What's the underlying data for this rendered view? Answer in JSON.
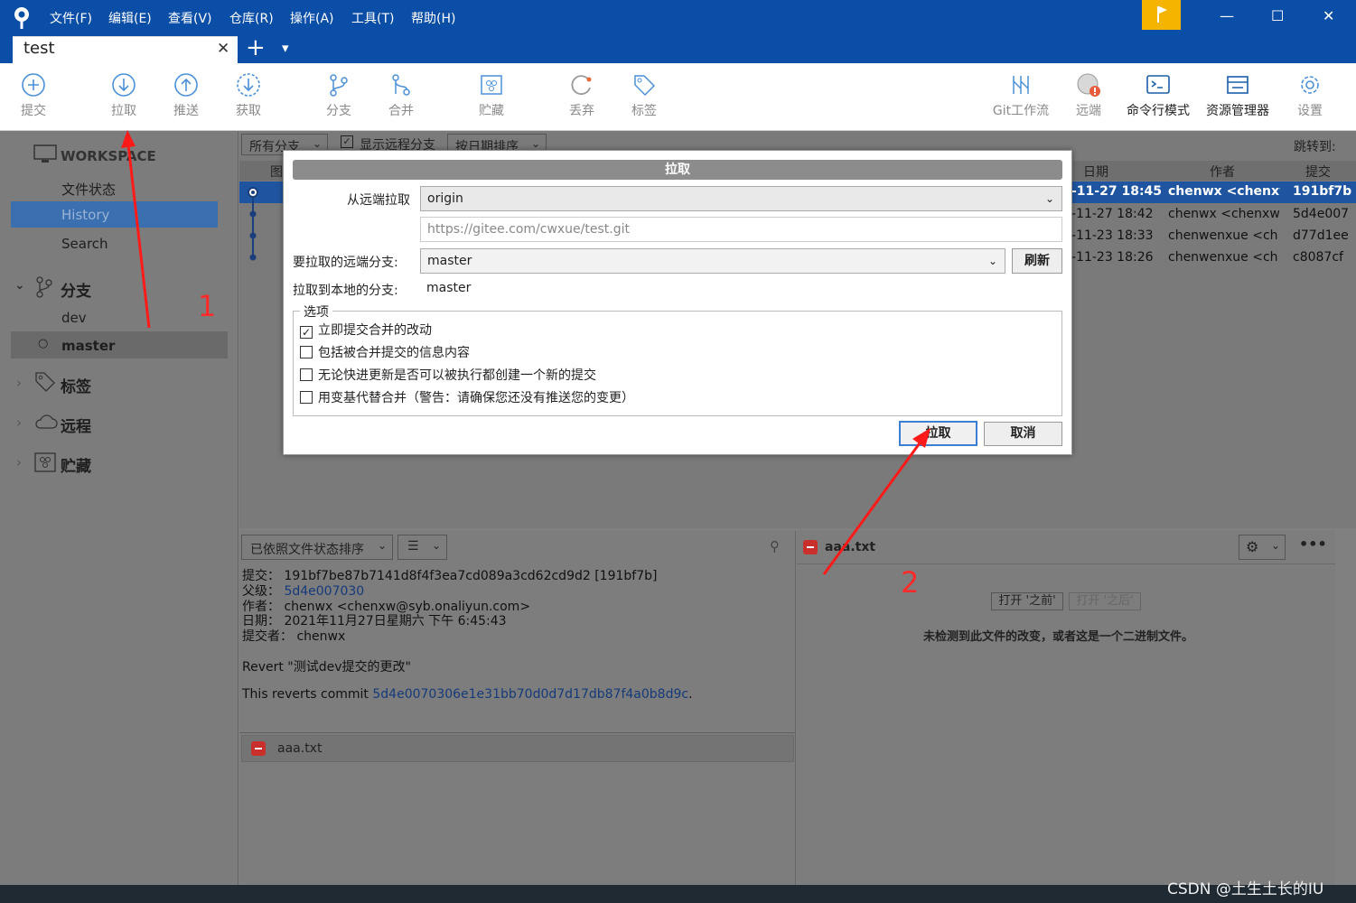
{
  "menu": [
    "文件(F)",
    "编辑(E)",
    "查看(V)",
    "仓库(R)",
    "操作(A)",
    "工具(T)",
    "帮助(H)"
  ],
  "tab": {
    "title": "test",
    "close": "✕",
    "add": "+",
    "dropdown": "▾"
  },
  "toolbar": {
    "commit": "提交",
    "pull": "拉取",
    "push": "推送",
    "fetch": "获取",
    "branch": "分支",
    "merge": "合并",
    "stash": "贮藏",
    "discard": "丢弃",
    "tag": "标签",
    "gitflow": "Git工作流",
    "remote": "远端",
    "terminal": "命令行模式",
    "explorer": "资源管理器",
    "settings": "设置"
  },
  "sidebar": {
    "workspace": "WORKSPACE",
    "file_status": "文件状态",
    "history": "History",
    "search": "Search",
    "branches": "分支",
    "branch_dev": "dev",
    "branch_master": "master",
    "tags": "标签",
    "remotes": "远程",
    "stashes": "贮藏"
  },
  "filterbar": {
    "all_branches": "所有分支",
    "show_remote": "显示远程分支",
    "sort": "按日期排序",
    "jump_to": "跳转到:"
  },
  "table": {
    "headers": {
      "graph": "图",
      "date": "日期",
      "author": "作者",
      "commit": "提交"
    },
    "rows": [
      {
        "date": "-11-27 18:45",
        "author": "chenwx <chenxw",
        "commit": "191bf7b"
      },
      {
        "date": "-11-27 18:42",
        "author": "chenwx <chenxw",
        "commit": "5d4e007"
      },
      {
        "date": "-11-23 18:33",
        "author": "chenwenxue <ch",
        "commit": "d77d1ee"
      },
      {
        "date": "-11-23 18:26",
        "author": "chenwenxue <ch",
        "commit": "c8087cf"
      }
    ]
  },
  "dialog": {
    "title": "拉取",
    "from_remote_label": "从远端拉取",
    "remote_value": "origin",
    "remote_url": "https://gitee.com/cwxue/test.git",
    "remote_branch_label": "要拉取的远端分支:",
    "remote_branch_value": "master",
    "refresh": "刷新",
    "local_branch_label": "拉取到本地的分支:",
    "local_branch_value": "master",
    "options_label": "选项",
    "options": [
      {
        "label": "立即提交合并的改动",
        "checked": true
      },
      {
        "label": "包括被合并提交的信息内容",
        "checked": false
      },
      {
        "label": "无论快进更新是否可以被执行都创建一个新的提交",
        "checked": false
      },
      {
        "label": "用变基代替合并（警告：请确保您还没有推送您的变更）",
        "checked": false
      }
    ],
    "ok": "拉取",
    "cancel": "取消"
  },
  "bottom_left": {
    "sort_label": "已依照文件状态排序",
    "commit_label": "提交：",
    "commit_value": "191bf7be87b7141d8f4f3ea7cd089a3cd62cd9d2 [191bf7b]",
    "parent_label": "父级：",
    "parent_value": "5d4e007030",
    "author_label": "作者：",
    "author_value": "chenwx <chenxw@syb.onaliyun.com>",
    "date_label": "日期：",
    "date_value": "2021年11月27日星期六 下午 6:45:43",
    "committer_label": "提交者：",
    "committer_value": "chenwx",
    "message": "Revert \"测试dev提交的更改\"",
    "reverts_prefix": "This reverts commit ",
    "reverts_hash": "5d4e0070306e1e31bb70d0d7d17db87f4a0b8d9c",
    "reverts_suffix": ".",
    "file": "aaa.txt"
  },
  "bottom_right": {
    "file": "aaa.txt",
    "open_before": "打开 '之前'",
    "open_after": "打开 '之后'",
    "notice": "未检测到此文件的改变，或者这是一个二进制文件。"
  },
  "annotations": {
    "one": "1",
    "two": "2"
  },
  "watermark": "CSDN @土生土长的IU"
}
